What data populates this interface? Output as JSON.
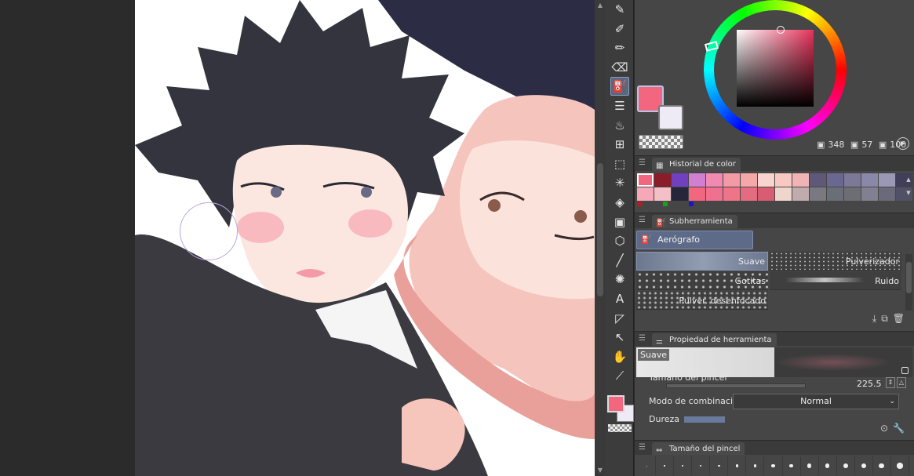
{
  "toolbar": {
    "tools": [
      {
        "name": "pen-tool-icon",
        "glyph": "✎",
        "active": false
      },
      {
        "name": "pencil-tool-icon",
        "glyph": "✐",
        "active": false
      },
      {
        "name": "brush-tool-icon",
        "glyph": "✏",
        "active": false
      },
      {
        "name": "eraser-tool-icon",
        "glyph": "⌫",
        "active": false
      },
      {
        "name": "airbrush-tool-icon",
        "glyph": "⛽",
        "active": true
      },
      {
        "name": "decoration-tool-icon",
        "glyph": "☰",
        "active": false
      },
      {
        "name": "blend-tool-icon",
        "glyph": "♨",
        "active": false
      },
      {
        "name": "ruler-tool-icon",
        "glyph": "⊞",
        "active": false
      },
      {
        "name": "selection-tool-icon",
        "glyph": "⬚",
        "active": false
      },
      {
        "name": "auto-select-tool-icon",
        "glyph": "✳",
        "active": false
      },
      {
        "name": "fill-tool-icon",
        "glyph": "◈",
        "active": false
      },
      {
        "name": "gradient-tool-icon",
        "glyph": "▣",
        "active": false
      },
      {
        "name": "3d-tool-icon",
        "glyph": "⬡",
        "active": false
      },
      {
        "name": "line-tool-icon",
        "glyph": "╱",
        "active": false
      },
      {
        "name": "speed-lines-tool-icon",
        "glyph": "✺",
        "active": false
      },
      {
        "name": "text-tool-icon",
        "glyph": "A",
        "active": false
      },
      {
        "name": "balloon-tool-icon",
        "glyph": "◸",
        "active": false
      },
      {
        "name": "object-tool-icon",
        "glyph": "↖",
        "active": false
      },
      {
        "name": "hand-tool-icon",
        "glyph": "✋",
        "active": false
      },
      {
        "name": "eyedropper-tool-icon",
        "glyph": "⟋",
        "active": false
      }
    ]
  },
  "colors": {
    "main": "#f2667f",
    "sub": "#eeeaf6",
    "accent_selected": "#5a6780"
  },
  "color_wheel": {
    "h_value": "348",
    "s_value": "57",
    "v_value": "100"
  },
  "history": {
    "title": "Historial de color",
    "row1": [
      "#f2667f",
      "#8b1d2a",
      "#7040c0",
      "#d080d0",
      "#f08ab0",
      "#f29aa6",
      "#f4a8aa",
      "#f9d4ce",
      "#f8c8c2",
      "#f0b4b6",
      "#605878",
      "#6a6890",
      "#7c7898",
      "#8a88a8",
      "#9a98b4",
      "#403e58"
    ],
    "row2": [
      "#f7a8b8",
      "#f4c0c8",
      "#26263a",
      "#f2667f",
      "#f07090",
      "#ef7488",
      "#e46c80",
      "#d85c72",
      "#eed6cc",
      "#c0acac",
      "#7a7880",
      "#6a6e78",
      "#6c6e74",
      "#808090",
      "#6a6a7a",
      "#505066"
    ],
    "marks": [
      "#c01818",
      "#18a018",
      "#1818c8"
    ]
  },
  "subtool": {
    "title": "Subherramienta",
    "group": "Aerógrafo",
    "brushes": [
      {
        "label": "Suave",
        "selected": true
      },
      {
        "label": "Pulverizador",
        "selected": false
      },
      {
        "label": "Gotitas",
        "selected": false
      },
      {
        "label": "Ruido",
        "selected": false
      },
      {
        "label": "Pulver. desenfocado",
        "selected": false
      }
    ]
  },
  "toolprop": {
    "title": "Propiedad de herramienta",
    "preview_name": "Suave",
    "brush_size_label": "Tamaño del pincel",
    "brush_size_value": "225.5",
    "blend_label": "Modo de combinación",
    "blend_value": "Normal",
    "hardness_label": "Dureza"
  },
  "sizepanel": {
    "title": "Tamaño del pincel"
  }
}
